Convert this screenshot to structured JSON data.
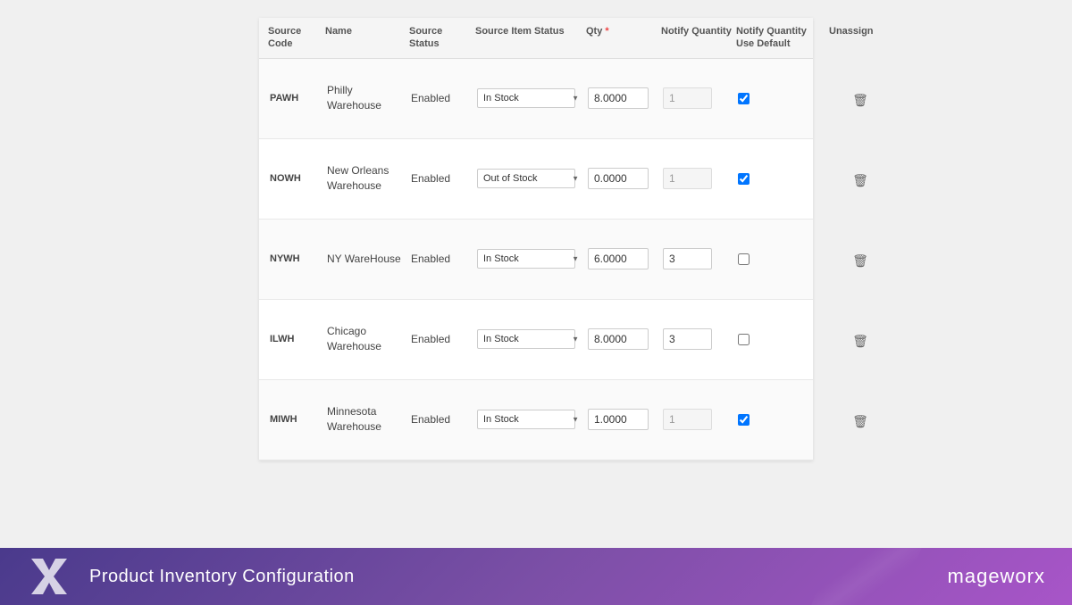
{
  "header": {
    "columns": [
      {
        "id": "source-code",
        "label": "Source Code"
      },
      {
        "id": "name",
        "label": "Name"
      },
      {
        "id": "source-status",
        "label": "Source Status"
      },
      {
        "id": "source-item-status",
        "label": "Source Item Status"
      },
      {
        "id": "qty",
        "label": "Qty",
        "required": true
      },
      {
        "id": "notify-quantity",
        "label": "Notify Quantity"
      },
      {
        "id": "notify-quantity-use-default",
        "label": "Notify Quantity Use Default"
      },
      {
        "id": "unassign",
        "label": "Unassign"
      }
    ]
  },
  "rows": [
    {
      "code": "PAWH",
      "name": "Philly Warehouse",
      "sourceStatus": "Enabled",
      "sourceItemStatus": "In Stock",
      "qty": "8.0000",
      "notifyQty": "1",
      "notifyQtyDisabled": true,
      "useDefault": true
    },
    {
      "code": "NOWH",
      "name": "New Orleans Warehouse",
      "sourceStatus": "Enabled",
      "sourceItemStatus": "Out of Stock",
      "qty": "0.0000",
      "notifyQty": "1",
      "notifyQtyDisabled": true,
      "useDefault": true
    },
    {
      "code": "NYWH",
      "name": "NY WareHouse",
      "sourceStatus": "Enabled",
      "sourceItemStatus": "In Stock",
      "qty": "6.0000",
      "notifyQty": "3",
      "notifyQtyDisabled": false,
      "useDefault": false
    },
    {
      "code": "ILWH",
      "name": "Chicago Warehouse",
      "sourceStatus": "Enabled",
      "sourceItemStatus": "In Stock",
      "qty": "8.0000",
      "notifyQty": "3",
      "notifyQtyDisabled": false,
      "useDefault": false
    },
    {
      "code": "MIWH",
      "name": "Minnesota Warehouse",
      "sourceStatus": "Enabled",
      "sourceItemStatus": "In Stock",
      "qty": "1.0000",
      "notifyQty": "1",
      "notifyQtyDisabled": true,
      "useDefault": true
    }
  ],
  "selectOptions": [
    "In Stock",
    "Out of Stock"
  ],
  "footer": {
    "title": "Product Inventory Configuration",
    "brand": "mageworx",
    "brandHighlight": "x",
    "trashIcon": "🗑"
  }
}
